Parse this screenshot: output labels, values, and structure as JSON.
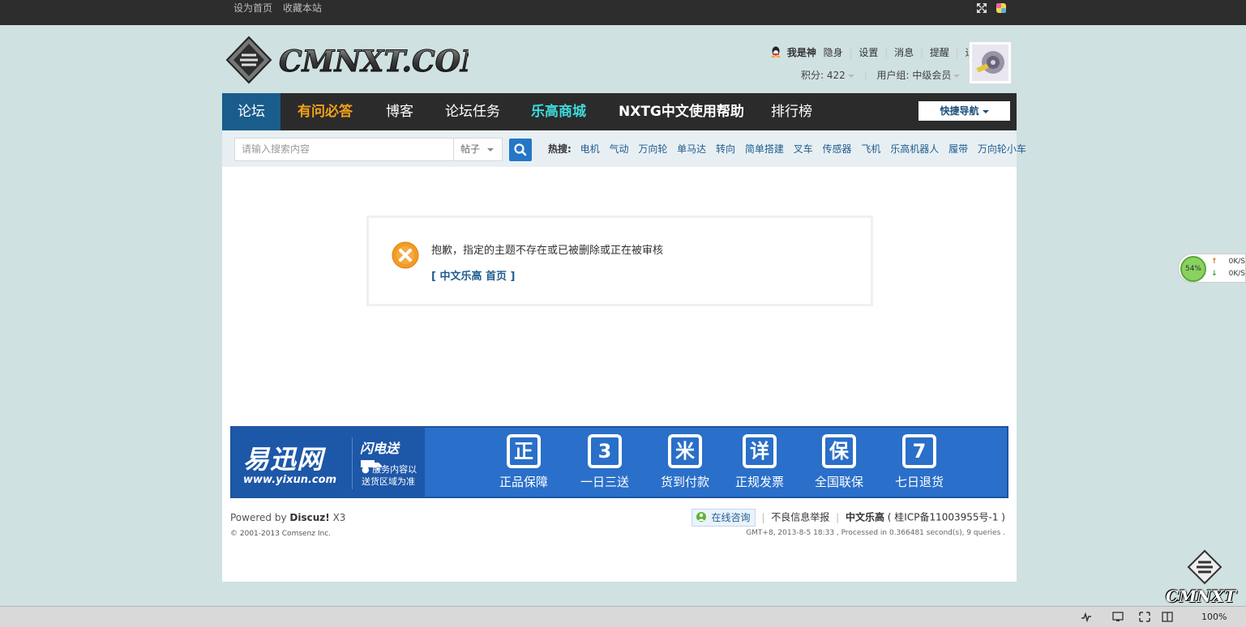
{
  "topbar": {
    "set_home": "设为首页",
    "bookmark": "收藏本站"
  },
  "header": {
    "logo_text": "CMNXT.COM",
    "user": {
      "name": "我是神",
      "links": [
        "隐身",
        "设置",
        "消息",
        "提醒",
        "退出"
      ],
      "points_label": "积分: 422",
      "group_label": "用户组: 中级会员"
    }
  },
  "nav": {
    "items": [
      {
        "label": "论坛",
        "style": "active"
      },
      {
        "label": "有问必答",
        "style": "orange"
      },
      {
        "label": "博客",
        "style": "normal"
      },
      {
        "label": "论坛任务",
        "style": "normal"
      },
      {
        "label": "乐高商城",
        "style": "cyan"
      },
      {
        "label": "NXTG中文使用帮助",
        "style": "bold"
      },
      {
        "label": "排行榜",
        "style": "normal"
      }
    ],
    "quick_nav": "快捷导航"
  },
  "search": {
    "placeholder": "请输入搜索内容",
    "type": "帖子",
    "hot_label": "热搜:",
    "hot_terms": [
      "电机",
      "气动",
      "万向轮",
      "单马达",
      "转向",
      "简单搭建",
      "叉车",
      "传感器",
      "飞机",
      "乐高机器人",
      "履带",
      "万向轮小车"
    ]
  },
  "alert": {
    "message": "抱歉，指定的主题不存在或已被删除或正在被审核",
    "link": "[ 中文乐高  首页 ]"
  },
  "banner": {
    "brand": "易迅网",
    "url": "www.yixun.com",
    "flash": "闪电送",
    "note_line1": "● 服务内容以",
    "note_line2": "送货区域为准",
    "features": [
      {
        "glyph": "正",
        "label": "正品保障"
      },
      {
        "glyph": "3",
        "label": "一日三送"
      },
      {
        "glyph": "米",
        "label": "货到付款"
      },
      {
        "glyph": "详",
        "label": "正规发票"
      },
      {
        "glyph": "保",
        "label": "全国联保"
      },
      {
        "glyph": "7",
        "label": "七日退货"
      }
    ]
  },
  "footer": {
    "powered_prefix": "Powered by",
    "powered_name": "Discuz!",
    "powered_version": "X3",
    "copyright": "© 2001-2013 Comsenz Inc.",
    "online_consult": "在线咨询",
    "report": "不良信息举报",
    "site_name": "中文乐高",
    "icp": "( 桂ICP备11003955号-1 )",
    "stat": "GMT+8, 2013-8-5 18:33 , Processed in 0.366481 second(s), 9 queries ."
  },
  "speed_widget": {
    "percent": "54%",
    "up": "0K/S",
    "down": "0K/S"
  },
  "watermark": {
    "text": "CMNXT"
  },
  "statusbar": {
    "zoom": "100%"
  },
  "colors": {
    "nav_bg": "#2b2b2b",
    "nav_active": "#1a5c8c",
    "link_blue": "#1f5d8f",
    "page_bg": "#cfe1e0"
  }
}
